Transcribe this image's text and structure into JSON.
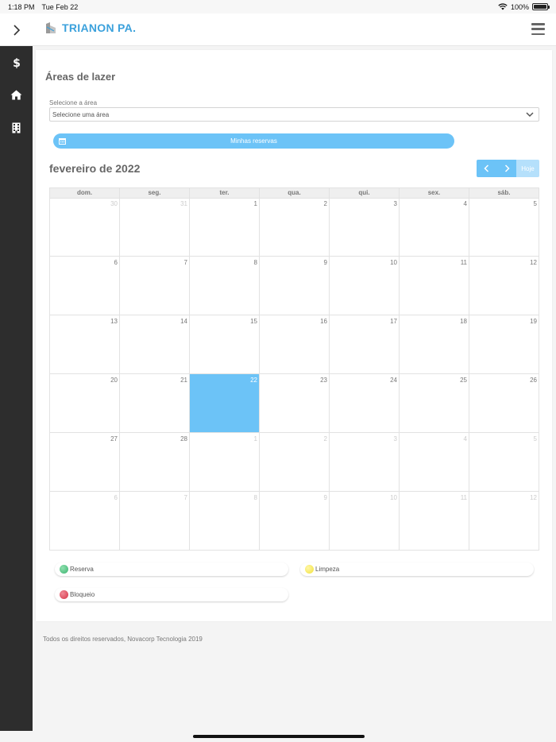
{
  "status_bar": {
    "time": "1:18 PM",
    "date": "Tue Feb 22",
    "battery": "100%"
  },
  "header": {
    "brand": "TRIANON PA."
  },
  "sidebar": {
    "items": [
      {
        "icon": "dollar-icon"
      },
      {
        "icon": "home-icon"
      },
      {
        "icon": "building-icon"
      }
    ]
  },
  "page": {
    "title": "Áreas de lazer",
    "select_label": "Selecione a área",
    "select_value": "Selecione uma área",
    "reservas_button": "Minhas reservas"
  },
  "calendar": {
    "month_title": "fevereiro de 2022",
    "today_label": "Hoje",
    "weekdays": [
      "dom.",
      "seg.",
      "ter.",
      "qua.",
      "qui.",
      "sex.",
      "sáb."
    ],
    "weeks": [
      [
        {
          "d": "30",
          "o": true
        },
        {
          "d": "31",
          "o": true
        },
        {
          "d": "1"
        },
        {
          "d": "2"
        },
        {
          "d": "3"
        },
        {
          "d": "4"
        },
        {
          "d": "5"
        }
      ],
      [
        {
          "d": "6"
        },
        {
          "d": "7"
        },
        {
          "d": "8"
        },
        {
          "d": "9"
        },
        {
          "d": "10"
        },
        {
          "d": "11"
        },
        {
          "d": "12"
        }
      ],
      [
        {
          "d": "13"
        },
        {
          "d": "14"
        },
        {
          "d": "15"
        },
        {
          "d": "16"
        },
        {
          "d": "17"
        },
        {
          "d": "18"
        },
        {
          "d": "19"
        }
      ],
      [
        {
          "d": "20"
        },
        {
          "d": "21"
        },
        {
          "d": "22",
          "today": true
        },
        {
          "d": "23"
        },
        {
          "d": "24"
        },
        {
          "d": "25"
        },
        {
          "d": "26"
        }
      ],
      [
        {
          "d": "27"
        },
        {
          "d": "28"
        },
        {
          "d": "1",
          "o": true
        },
        {
          "d": "2",
          "o": true
        },
        {
          "d": "3",
          "o": true
        },
        {
          "d": "4",
          "o": true
        },
        {
          "d": "5",
          "o": true
        }
      ],
      [
        {
          "d": "6",
          "o": true
        },
        {
          "d": "7",
          "o": true
        },
        {
          "d": "8",
          "o": true
        },
        {
          "d": "9",
          "o": true
        },
        {
          "d": "10",
          "o": true
        },
        {
          "d": "11",
          "o": true
        },
        {
          "d": "12",
          "o": true
        }
      ]
    ]
  },
  "legend": {
    "reserva": {
      "label": "Reserva",
      "color": "#3cb371"
    },
    "limpeza": {
      "label": "Limpeza",
      "color": "#f2e23a"
    },
    "bloqueio": {
      "label": "Bloqueio",
      "color": "#d63447"
    }
  },
  "colors": {
    "accent": "#6cc3f7",
    "brand": "#3ba1dc",
    "sidebar": "#2d2d2d"
  },
  "footer": {
    "text": "Todos os direitos reservados, Novacorp Tecnologia 2019"
  }
}
